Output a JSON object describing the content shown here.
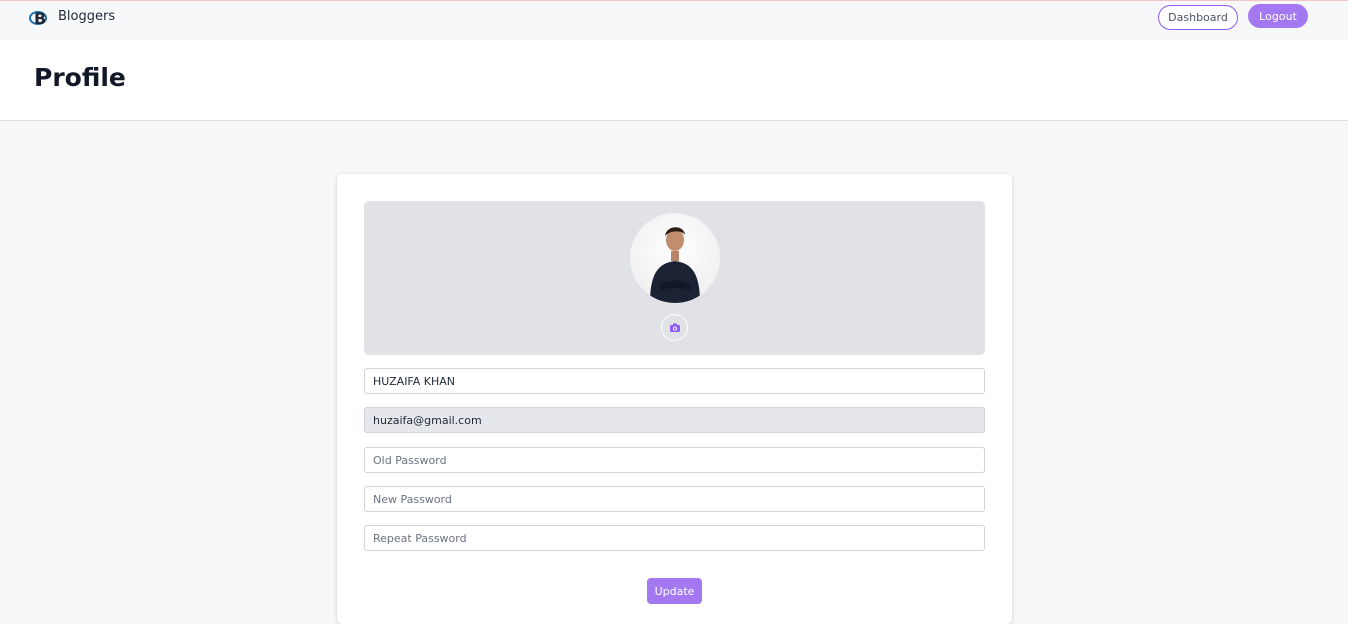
{
  "nav": {
    "brand_name": "Bloggers",
    "dashboard_label": "Dashboard",
    "logout_label": "Logout"
  },
  "header": {
    "title": "Profile"
  },
  "profile": {
    "name_value": "HUZAIFA KHAN",
    "email_value": "huzaifa@gmail.com",
    "old_password_placeholder": "Old Password",
    "new_password_placeholder": "New Password",
    "repeat_password_placeholder": "Repeat Password",
    "update_label": "Update",
    "avatar_icon": "person-photo",
    "camera_icon": "camera-icon"
  },
  "colors": {
    "accent": "#a478f0",
    "cover": "#e0e2e6"
  }
}
